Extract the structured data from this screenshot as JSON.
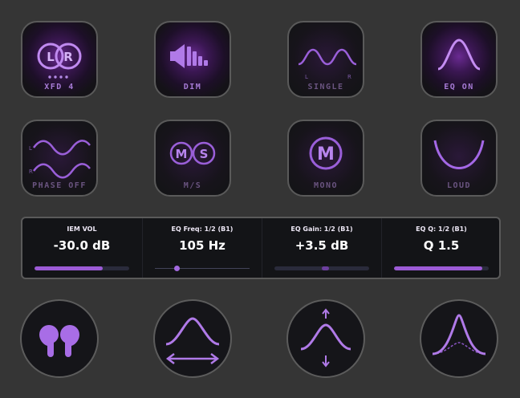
{
  "colors": {
    "background": "#353535",
    "key_face": "#161619",
    "accent": "#a46ee8",
    "accent_dim": "#6a5480",
    "value_text": "#ffffff"
  },
  "keys": {
    "xfd": {
      "label": "XFD 4",
      "active": true,
      "icon": "lr-xfd-icon",
      "icon_left": "L",
      "icon_right": "R"
    },
    "dim": {
      "label": "DIM",
      "active": true,
      "icon": "dim-speaker-icon"
    },
    "single": {
      "label": "SINGLE",
      "active": false,
      "icon": "single-curve-icon",
      "icon_left": "L",
      "icon_right": "R"
    },
    "eq": {
      "label": "EQ ON",
      "active": true,
      "icon": "bell-curve-icon"
    },
    "phase": {
      "label": "PHASE OFF",
      "active": false,
      "icon": "phase-waves-icon",
      "icon_left": "L",
      "icon_right": "R"
    },
    "ms": {
      "label": "M/S",
      "active": false,
      "icon": "ms-icon",
      "icon_m": "M",
      "icon_s": "S"
    },
    "mono": {
      "label": "MONO",
      "active": false,
      "icon": "mono-icon",
      "icon_m": "M"
    },
    "loud": {
      "label": "LOUD",
      "active": false,
      "icon": "loudness-curve-icon"
    }
  },
  "displays": [
    {
      "title": "IEM VOL",
      "value": "-30.0 dB",
      "indicator": "bar",
      "level": 0.72
    },
    {
      "title": "EQ Freq: 1/2 (B1)",
      "value": "105 Hz",
      "indicator": "dot",
      "level": 0.23
    },
    {
      "title": "EQ Gain: 1/2 (B1)",
      "value": "+3.5 dB",
      "indicator": "bipolar",
      "level": 0.58
    },
    {
      "title": "EQ Q: 1/2 (B1)",
      "value": "Q 1.5",
      "indicator": "bar",
      "level": 0.93
    }
  ],
  "knobs": [
    {
      "icon": "earbuds-icon",
      "function": "IEM VOL"
    },
    {
      "icon": "eq-frequency-icon",
      "function": "EQ Freq"
    },
    {
      "icon": "eq-gain-icon",
      "function": "EQ Gain"
    },
    {
      "icon": "eq-q-icon",
      "function": "EQ Q"
    }
  ]
}
